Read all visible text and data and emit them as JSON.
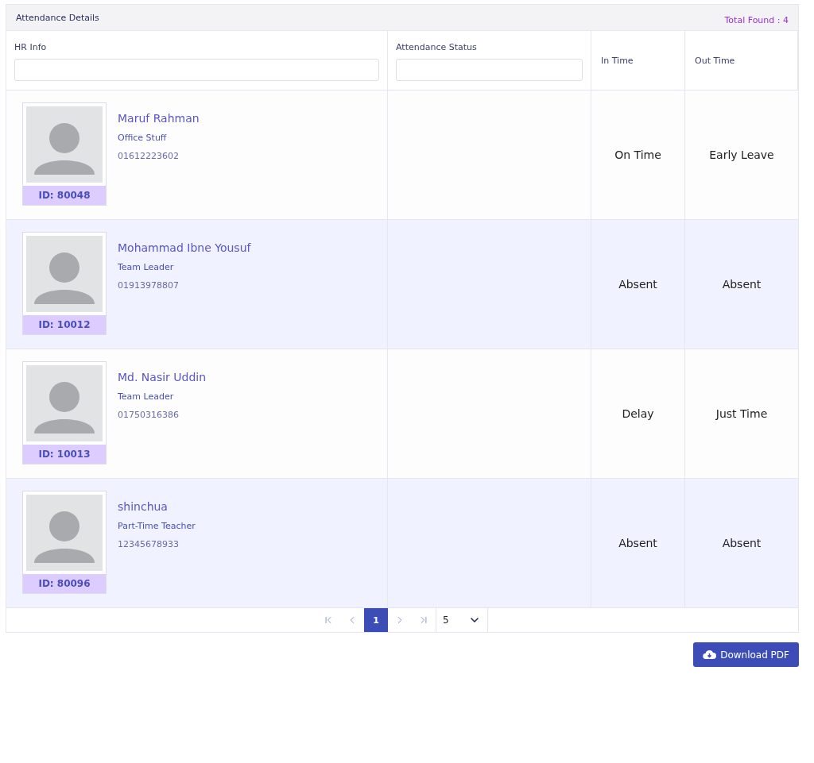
{
  "panel": {
    "title": "Attendance Details",
    "total": "Total Found : 4"
  },
  "columns": [
    {
      "label": "HR Info",
      "kind": "filter"
    },
    {
      "label": "Attendance Status",
      "kind": "filter"
    },
    {
      "label": "In Time",
      "kind": "plain"
    },
    {
      "label": "Out Time",
      "kind": "plain"
    }
  ],
  "rows": [
    {
      "name": "Maruf Rahman",
      "role": "Office Stuff",
      "phone": "01612223602",
      "id": "ID: 80048",
      "in_time": "On Time",
      "out_time": "Early Leave"
    },
    {
      "name": "Mohammad Ibne Yousuf",
      "role": "Team Leader",
      "phone": "01913978807",
      "id": "ID: 10012",
      "in_time": "Absent",
      "out_time": "Absent"
    },
    {
      "name": "Md. Nasir Uddin",
      "role": "Team Leader",
      "phone": "01750316386",
      "id": "ID: 10013",
      "in_time": "Delay",
      "out_time": "Just Time"
    },
    {
      "name": "shinchua",
      "role": "Part-Time Teacher",
      "phone": "12345678933",
      "id": "ID: 80096",
      "in_time": "Absent",
      "out_time": "Absent"
    }
  ],
  "pagination": {
    "pages": [
      {
        "label": "1",
        "selected": true
      }
    ],
    "page_size": "5"
  },
  "download_button": "Download PDF"
}
